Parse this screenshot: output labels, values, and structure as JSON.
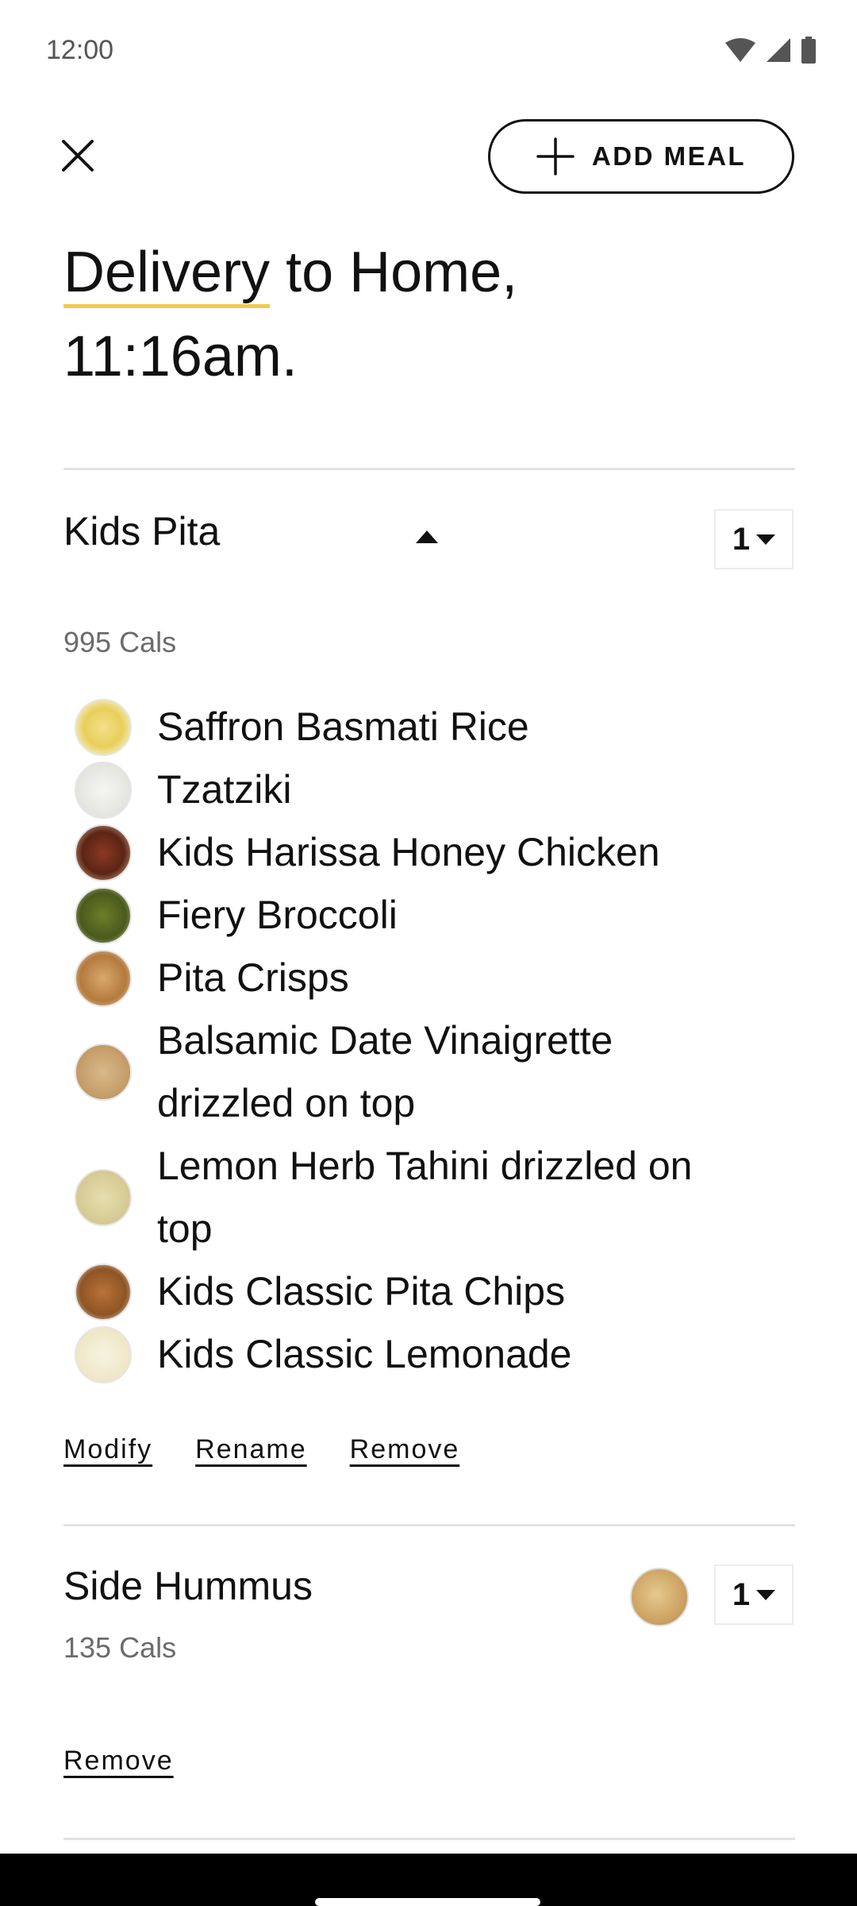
{
  "status_bar": {
    "time": "12:00",
    "icons": [
      "wifi-icon",
      "signal-icon",
      "battery-icon"
    ]
  },
  "top_bar": {
    "close_icon": "close-icon",
    "add_meal_icon": "plus-icon",
    "add_meal_label": "ADD MEAL"
  },
  "headline": {
    "underlined_word": "Delivery",
    "rest_line1": " to Home,",
    "line2": "11:16am."
  },
  "items": [
    {
      "title": "Kids Pita",
      "expanded": true,
      "quantity": "1",
      "calories": "995 Cals",
      "ingredients": [
        {
          "name": "Saffron Basmati Rice"
        },
        {
          "name": "Tzatziki"
        },
        {
          "name": "Kids Harissa Honey Chicken"
        },
        {
          "name": "Fiery Broccoli"
        },
        {
          "name": "Pita Crisps"
        },
        {
          "name": "Balsamic Date Vinaigrette drizzled on top"
        },
        {
          "name": "Lemon Herb Tahini drizzled on top"
        },
        {
          "name": "Kids Classic Pita Chips"
        },
        {
          "name": "Kids Classic Lemonade"
        }
      ],
      "actions": {
        "modify": "Modify",
        "rename": "Rename",
        "remove": "Remove"
      }
    },
    {
      "title": "Side Hummus",
      "quantity": "1",
      "calories": "135 Cals",
      "actions": {
        "remove": "Remove"
      }
    }
  ],
  "colors": {
    "accent_underline": "#f2c94c",
    "text": "#111111",
    "muted": "#6b6b6b",
    "divider": "#e2e2e2"
  }
}
